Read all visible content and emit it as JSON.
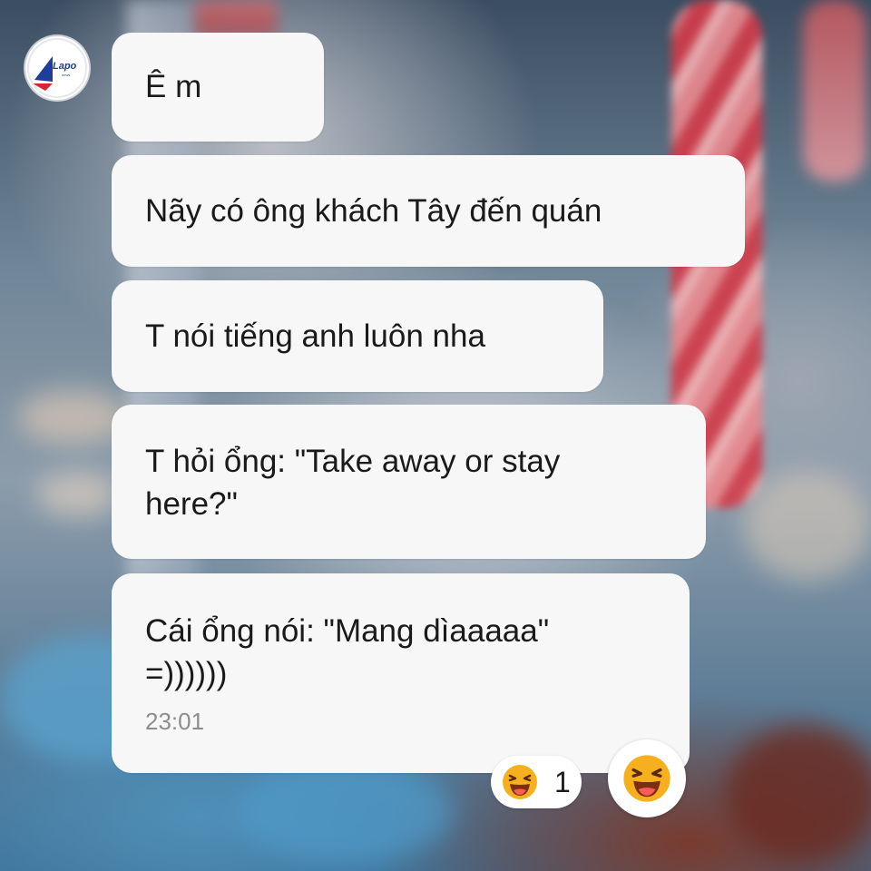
{
  "logo": {
    "text": "Lapo",
    "subtext": "news",
    "icon": "lapo-logo-icon"
  },
  "messages": [
    {
      "lines": [
        "Ê m"
      ]
    },
    {
      "lines": [
        "Nãy có ông khách Tây đến quán"
      ]
    },
    {
      "lines": [
        "T nói tiếng anh luôn nha"
      ]
    },
    {
      "lines": [
        "T hỏi ổng: \"Take away or stay",
        "here?\""
      ]
    },
    {
      "lines": [
        "Cái ổng nói: \"Mang dìaaaaa\"",
        "=))))))"
      ],
      "timestamp": "23:01"
    }
  ],
  "reactions": {
    "pill": {
      "icon": "laughing-emoji-icon",
      "count": "1"
    },
    "button": {
      "icon": "laughing-emoji-icon"
    }
  },
  "colors": {
    "bubble": "#f7f7f7",
    "text": "#1a1a1a",
    "timestamp": "#8d8d8d",
    "emoji_face": "#f6b01e",
    "emoji_mouth": "#7a2e12"
  }
}
